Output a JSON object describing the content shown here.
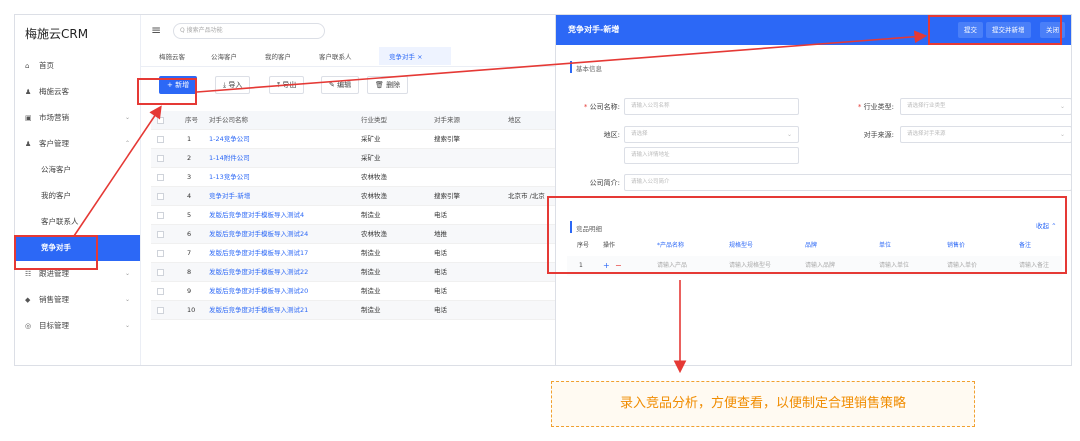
{
  "app": {
    "title": "梅施云CRM"
  },
  "sidebar": {
    "items": [
      {
        "label": "首页",
        "icon": "home-icon",
        "glyph": "⌂",
        "chev": ""
      },
      {
        "label": "梅施云客",
        "icon": "users-icon",
        "glyph": "♟",
        "chev": ""
      },
      {
        "label": "市场营销",
        "icon": "marketing-icon",
        "glyph": "▣",
        "chev": "⌄"
      },
      {
        "label": "客户管理",
        "icon": "customer-icon",
        "glyph": "♟",
        "chev": "⌃"
      }
    ],
    "sub_items": [
      "公海客户",
      "我的客户",
      "客户联系人",
      "竞争对手"
    ],
    "bottom_items": [
      {
        "label": "跟进管理",
        "icon": "follow-icon",
        "glyph": "☷",
        "chev": "⌄"
      },
      {
        "label": "销售管理",
        "icon": "sales-icon",
        "glyph": "◆",
        "chev": "⌄"
      },
      {
        "label": "目标管理",
        "icon": "target-icon",
        "glyph": "◎",
        "chev": "⌄"
      }
    ]
  },
  "topbar": {
    "search_placeholder": "Q 搜索产品功能"
  },
  "tabs": [
    "梅施云客",
    "公海客户",
    "我的客户",
    "客户联系人",
    "竞争对手 ×"
  ],
  "toolbar": {
    "add": "+ 新增",
    "import": "⤓ 导入",
    "export": "⤒ 导出",
    "edit": "✎ 编辑",
    "delete": "🗑 删除"
  },
  "table": {
    "headers": {
      "seq": "序号",
      "name": "对手公司名称",
      "industry": "行业类型",
      "source": "对手来源",
      "region": "地区"
    },
    "rows": [
      {
        "seq": "1",
        "name": "1-24竞争公司",
        "industry": "采矿业",
        "source": "搜索引擎",
        "region": ""
      },
      {
        "seq": "2",
        "name": "1-14附件公司",
        "industry": "采矿业",
        "source": "",
        "region": ""
      },
      {
        "seq": "3",
        "name": "1-13竞争公司",
        "industry": "农林牧渔",
        "source": "",
        "region": ""
      },
      {
        "seq": "4",
        "name": "竞争对手-新增",
        "industry": "农林牧渔",
        "source": "搜索引擎",
        "region": "北京市 /北京"
      },
      {
        "seq": "5",
        "name": "发版后竞争度对手模板导入测试4",
        "industry": "制造业",
        "source": "电话",
        "region": ""
      },
      {
        "seq": "6",
        "name": "发版后竞争度对手模板导入测试24",
        "industry": "农林牧渔",
        "source": "地推",
        "region": ""
      },
      {
        "seq": "7",
        "name": "发版后竞争度对手模板导入测试17",
        "industry": "制造业",
        "source": "电话",
        "region": ""
      },
      {
        "seq": "8",
        "name": "发版后竞争度对手模板导入测试22",
        "industry": "制造业",
        "source": "电话",
        "region": ""
      },
      {
        "seq": "9",
        "name": "发版后竞争度对手模板导入测试20",
        "industry": "制造业",
        "source": "电话",
        "region": ""
      },
      {
        "seq": "10",
        "name": "发版后竞争度对手模板导入测试21",
        "industry": "制造业",
        "source": "电话",
        "region": ""
      }
    ]
  },
  "dialog": {
    "title": "竞争对手-新增",
    "submit": "提交",
    "submit_new": "提交并新增",
    "close": "关闭",
    "section_basic": "基本信息",
    "fields": {
      "company_label": "公司名称:",
      "company_ph": "请输入公司名称",
      "industry_label": "行业类型:",
      "industry_ph": "请选择行业类型",
      "region_label": "地区:",
      "region_ph": "请选择",
      "address_ph": "请输入详情地址",
      "source_label": "对手来源:",
      "source_ph": "请选择对手来源",
      "intro_label": "公司简介:",
      "intro_ph": "请输入公司简介"
    },
    "products": {
      "title": "竞品明细",
      "collapse": "收起 ⌃",
      "headers": [
        "序号",
        "操作",
        "*产品名称",
        "规格型号",
        "品牌",
        "单位",
        "销售价",
        "备注"
      ],
      "row": {
        "seq": "1",
        "plus": "+",
        "minus": "−",
        "values": [
          "请输入产品",
          "请输入规格型号",
          "请输入品牌",
          "请输入单位",
          "请输入单价",
          "请输入备注"
        ]
      }
    }
  },
  "callout": {
    "text": "录入竞品分析，方便查看，以便制定合理销售策略"
  },
  "colors": {
    "primary": "#2c68f6",
    "annotation_red": "#e53935",
    "callout_orange": "#f08c00"
  }
}
